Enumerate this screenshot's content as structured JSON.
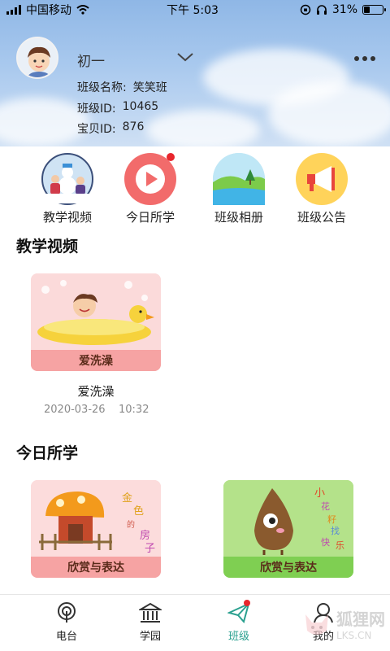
{
  "status_bar": {
    "carrier": "中国移动",
    "time": "下午 5:03",
    "battery": "31%",
    "battery_level": 0.31
  },
  "header": {
    "user_name": "初一",
    "class_name_label": "班级名称:",
    "class_name_value": "笑笑班",
    "class_id_label": "班级ID:",
    "class_id_value": "10465",
    "baby_id_label": "宝贝ID:",
    "baby_id_value": "876"
  },
  "quick_menu": [
    {
      "label": "教学视频",
      "icon": "snowman-family-icon"
    },
    {
      "label": "今日所学",
      "icon": "play-icon",
      "badge": true
    },
    {
      "label": "班级相册",
      "icon": "landscape-icon"
    },
    {
      "label": "班级公告",
      "icon": "megaphone-icon"
    }
  ],
  "sections": {
    "videos_title": "教学视频",
    "today_title": "今日所学"
  },
  "videos": [
    {
      "banner": "爱洗澡",
      "title": "爱洗澡",
      "date": "2020-03-26",
      "time": "10:32"
    }
  ],
  "today": [
    {
      "banner": "欣赏与表达",
      "side_text": "金色的房子"
    },
    {
      "banner": "欣赏与表达",
      "side_text": "小花籽找快乐"
    }
  ],
  "bottom_nav": [
    {
      "label": "电台",
      "icon": "radio-icon"
    },
    {
      "label": "学园",
      "icon": "school-icon"
    },
    {
      "label": "班级",
      "icon": "paper-plane-icon",
      "active": true,
      "badge": true
    },
    {
      "label": "我的",
      "icon": "profile-icon"
    }
  ],
  "watermark": {
    "title": "狐狸网",
    "url": "LKS.CN"
  },
  "colors": {
    "accent": "#2aa08f",
    "badge": "#e8262d",
    "sky": "#a9c9ee"
  }
}
